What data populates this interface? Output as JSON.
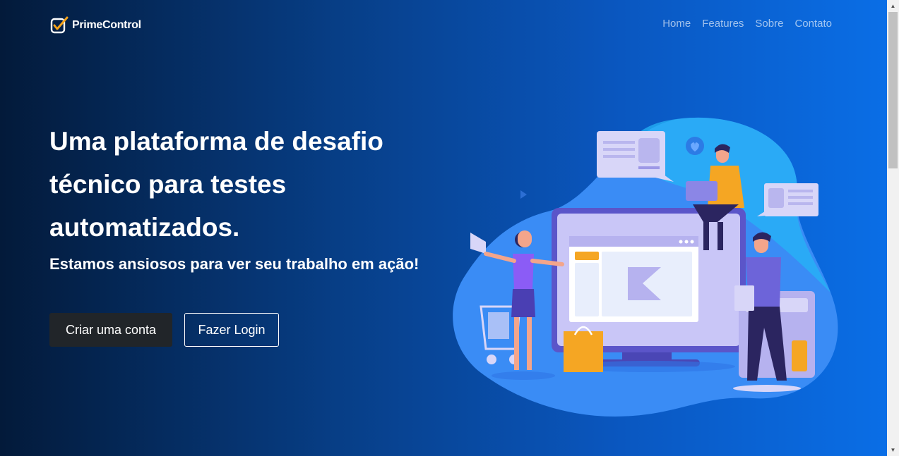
{
  "brand": {
    "name": "PrimeControl",
    "icon": "check-badge-icon"
  },
  "nav": {
    "items": [
      "Home",
      "Features",
      "Sobre",
      "Contato"
    ]
  },
  "hero": {
    "title": "Uma plataforma de desafio técnico para testes automatizados.",
    "subtitle": "Estamos ansiosos para ver seu trabalho em ação!",
    "primary_button": "Criar uma conta",
    "secondary_button": "Fazer Login"
  },
  "illustration": {
    "icon": "team-working-illustration"
  },
  "colors": {
    "gradient_start": "#031a3a",
    "gradient_end": "#0a6ee6",
    "button_dark": "#212529",
    "blob": "#3a8cf5"
  }
}
